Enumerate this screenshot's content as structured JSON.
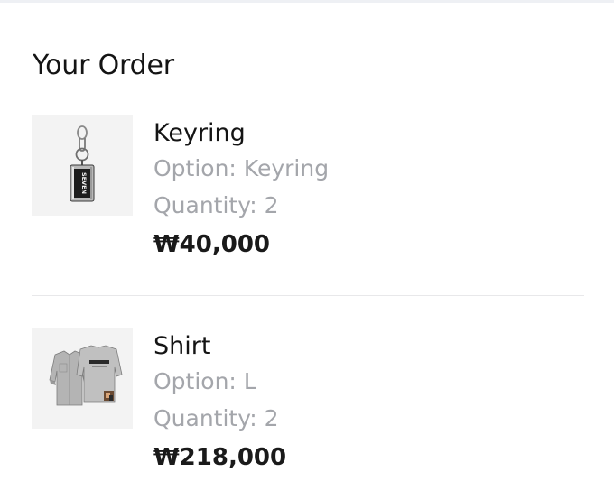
{
  "section_title": "Your Order",
  "items": [
    {
      "name": "Keyring",
      "option_label": "Option: ",
      "option_value": "Keyring",
      "quantity_label": "Quantity: ",
      "quantity_value": "2",
      "price": "₩40,000",
      "thumbnail_icon": "keyring-product-image",
      "thumbnail_text": "SEVEN"
    },
    {
      "name": "Shirt",
      "option_label": "Option: ",
      "option_value": "L",
      "quantity_label": "Quantity: ",
      "quantity_value": "2",
      "price": "₩218,000",
      "thumbnail_icon": "shirt-product-image"
    }
  ],
  "colors": {
    "text_primary": "#141414",
    "text_secondary": "#a4a6ab",
    "divider": "#e8e8ea",
    "thumbnail_bg": "#f3f3f3"
  }
}
